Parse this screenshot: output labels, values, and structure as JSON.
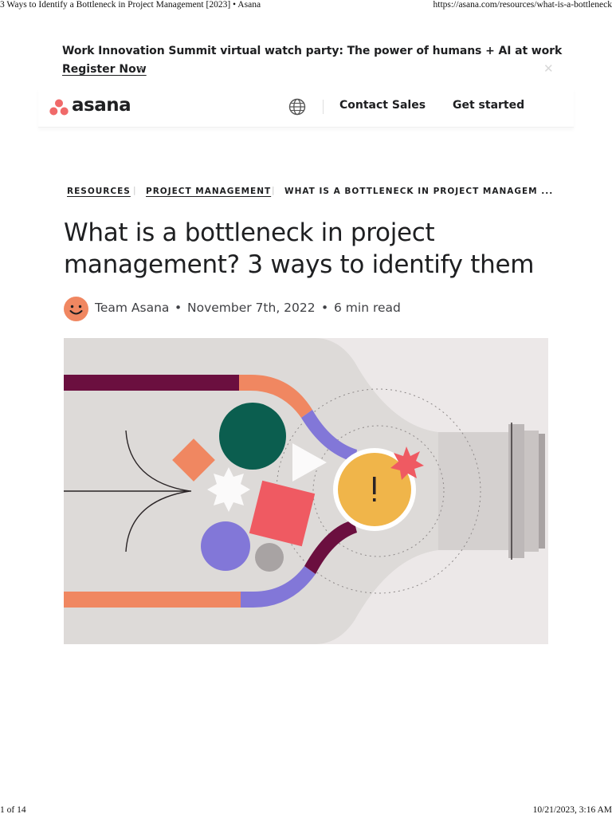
{
  "print": {
    "header_title": "3 Ways to Identify a Bottleneck in Project Management [2023] • Asana",
    "header_url": "https://asana.com/resources/what-is-a-bottleneck",
    "footer_page": "1 of 14",
    "footer_datetime": "10/21/2023, 3:16 AM"
  },
  "banner": {
    "text": "Work Innovation Summit virtual watch party: The power of humans + AI at work",
    "link_label": "Register Now",
    "arrow_icon": "arrow-right-icon",
    "close_icon": "close-icon"
  },
  "nav": {
    "logo_text": "asana",
    "globe_icon": "globe-icon",
    "contact_label": "Contact Sales",
    "started_label": "Get started"
  },
  "breadcrumb": {
    "items": [
      "Resources",
      "Project management",
      "What is a bottleneck in project managem ..."
    ]
  },
  "article": {
    "title": "What is a bottleneck in project management? 3 ways to identify them",
    "author": "Team Asana",
    "date": "November 7th, 2022",
    "read_time": "6 min read",
    "separator": "•"
  },
  "colors": {
    "brand_coral": "#f06a6a",
    "text_dark": "#1e1f21",
    "hero_bg": "#ece8e8",
    "plum": "#6b0f3f",
    "orange": "#f08761",
    "green": "#0b5e4f",
    "purple": "#8277d8",
    "gold": "#f0b54a",
    "red_square": "#ef5a62"
  }
}
